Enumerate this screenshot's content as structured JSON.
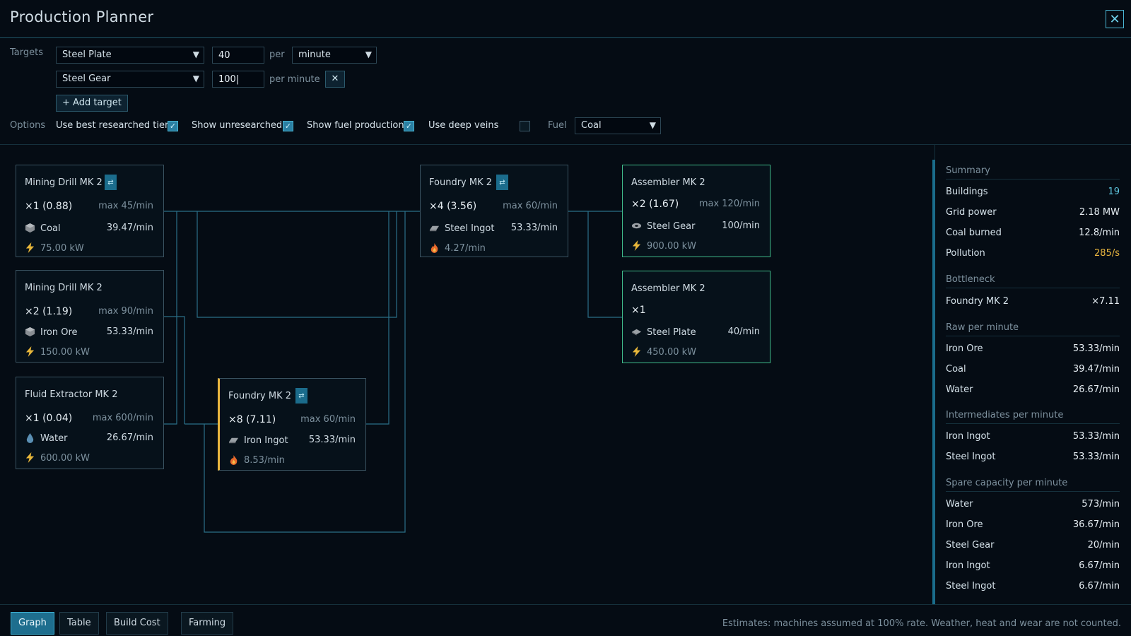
{
  "window": {
    "title": "Production Planner",
    "close_label": "✕"
  },
  "targets": {
    "label": "Targets",
    "rows": [
      {
        "item": "Steel Plate",
        "amount": "40",
        "per": "per",
        "unit": "minute"
      },
      {
        "item": "Steel Gear",
        "amount": "100|",
        "per": "per minute",
        "remove": "✕"
      }
    ],
    "add_label": "+ Add target"
  },
  "options": {
    "label": "Options",
    "use_best_tier": {
      "label": "Use best researched tier",
      "checked": true
    },
    "show_unresearched": {
      "label": "Show unresearched",
      "checked": true
    },
    "show_fuel_production": {
      "label": "Show fuel production",
      "checked": true
    },
    "use_deep_veins": {
      "label": "Use deep veins",
      "checked": false
    },
    "fuel_label": "Fuel",
    "fuel_value": "Coal"
  },
  "nodes": {
    "drill_coal": {
      "title": "Mining Drill MK 2",
      "count": "×1 (0.88)",
      "max": "max 45/min",
      "item": "Coal",
      "rate": "39.47/min",
      "power": "75.00 kW"
    },
    "drill_iron": {
      "title": "Mining Drill MK 2",
      "count": "×2 (1.19)",
      "max": "max 90/min",
      "item": "Iron Ore",
      "rate": "53.33/min",
      "power": "150.00 kW"
    },
    "extractor": {
      "title": "Fluid Extractor MK 2",
      "count": "×1 (0.04)",
      "max": "max 600/min",
      "item": "Water",
      "rate": "26.67/min",
      "power": "600.00 kW"
    },
    "foundry_steel": {
      "title": "Foundry MK 2",
      "count": "×4 (3.56)",
      "max": "max 60/min",
      "item": "Steel Ingot",
      "rate": "53.33/min",
      "fuel": "4.27/min"
    },
    "foundry_iron": {
      "title": "Foundry MK 2",
      "count": "×8 (7.11)",
      "max": "max 60/min",
      "item": "Iron Ingot",
      "rate": "53.33/min",
      "fuel": "8.53/min"
    },
    "assembler_gear": {
      "title": "Assembler MK 2",
      "count": "×2 (1.67)",
      "max": "max 120/min",
      "item": "Steel Gear",
      "rate": "100/min",
      "power": "900.00 kW"
    },
    "assembler_plate": {
      "title": "Assembler MK 2",
      "count": "×1",
      "item": "Steel Plate",
      "rate": "40/min",
      "power": "450.00 kW"
    },
    "swap_glyph": "⇄"
  },
  "summary": {
    "head": "Summary",
    "buildings": {
      "label": "Buildings",
      "value": "19"
    },
    "grid_power": {
      "label": "Grid power",
      "value": "2.18 MW"
    },
    "coal_burned": {
      "label": "Coal burned",
      "value": "12.8/min"
    },
    "pollution": {
      "label": "Pollution",
      "value": "285/s"
    },
    "bottleneck_head": "Bottleneck",
    "bottleneck": {
      "label": "Foundry MK 2",
      "value": "×7.11"
    },
    "raw_head": "Raw per minute",
    "raw": [
      {
        "label": "Iron Ore",
        "value": "53.33/min"
      },
      {
        "label": "Coal",
        "value": "39.47/min"
      },
      {
        "label": "Water",
        "value": "26.67/min"
      }
    ],
    "inter_head": "Intermediates per minute",
    "intermediates": [
      {
        "label": "Iron Ingot",
        "value": "53.33/min"
      },
      {
        "label": "Steel Ingot",
        "value": "53.33/min"
      }
    ],
    "spare_head": "Spare capacity per minute",
    "spare": [
      {
        "label": "Water",
        "value": "573/min"
      },
      {
        "label": "Iron Ore",
        "value": "36.67/min"
      },
      {
        "label": "Steel Gear",
        "value": "20/min"
      },
      {
        "label": "Iron Ingot",
        "value": "6.67/min"
      },
      {
        "label": "Steel Ingot",
        "value": "6.67/min"
      }
    ]
  },
  "tabs": [
    {
      "label": "Graph",
      "active": true
    },
    {
      "label": "Table",
      "active": false
    },
    {
      "label": "Build Cost",
      "active": false
    },
    {
      "label": "Farming",
      "active": false
    }
  ],
  "footer_note": "Estimates: machines assumed at 100% rate. Weather, heat and wear are not counted.",
  "colors": {
    "accent": "#5fc7e0",
    "node_ok_border": "#3fbb8a",
    "bottleneck": "#e9b63f",
    "wire": "#2b6f88"
  }
}
